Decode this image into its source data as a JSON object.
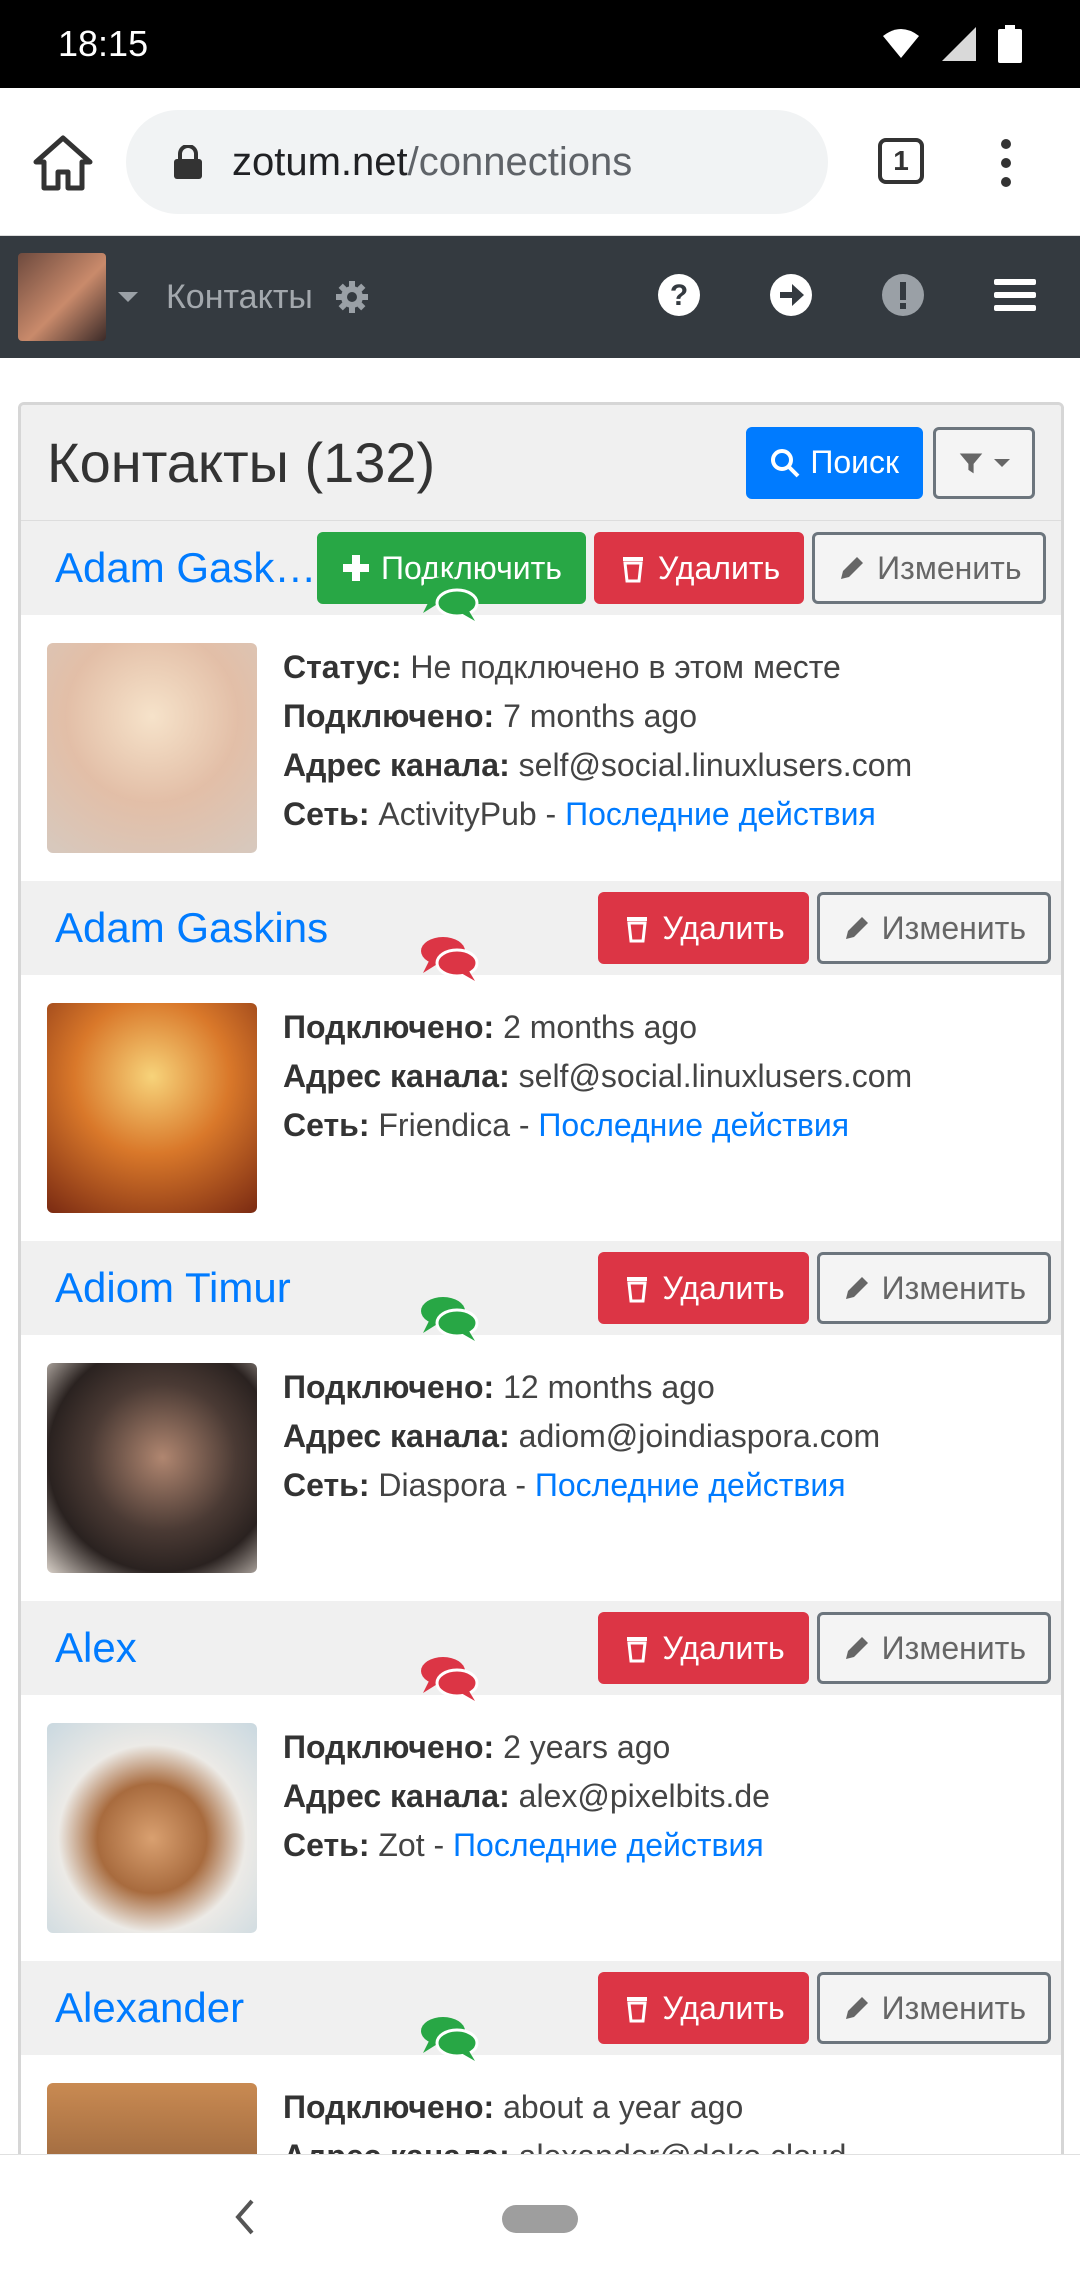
{
  "status_bar": {
    "time": "18:15"
  },
  "browser": {
    "url_domain": "zotum.net",
    "url_path": "/connections",
    "tab_count": "1"
  },
  "navbar": {
    "title": "Контакты"
  },
  "page": {
    "heading": "Контакты (132)",
    "search_label": "Поиск"
  },
  "labels": {
    "status": "Статус:",
    "connected": "Подключено:",
    "channel": "Адрес канала:",
    "network": "Сеть:",
    "sep": " - ",
    "recent": "Последние действия",
    "connect_btn": "Подключить",
    "delete_btn": "Удалить",
    "edit_btn": "Изменить"
  },
  "contacts": [
    {
      "name": "Adam Gaskins",
      "status": "Не подключено в этом месте",
      "connected": "7 months ago",
      "channel": "self@social.linuxlusers.com",
      "network": "ActivityPub",
      "chat_color": "#28a745"
    },
    {
      "name": "Adam Gaskins",
      "connected": "2 months ago",
      "channel": "self@social.linuxlusers.com",
      "network": "Friendica",
      "chat_color": "#dc3545"
    },
    {
      "name": "Adiom Timur",
      "connected": "12 months ago",
      "channel": "adiom@joindiaspora.com",
      "network": "Diaspora",
      "chat_color": "#28a745"
    },
    {
      "name": "Alex",
      "connected": "2 years ago",
      "channel": "alex@pixelbits.de",
      "network": "Zot",
      "chat_color": "#dc3545"
    },
    {
      "name": "Alexander",
      "connected": "about a year ago",
      "channel": "alexander@deko.cloud",
      "chat_color": "#28a745"
    }
  ]
}
